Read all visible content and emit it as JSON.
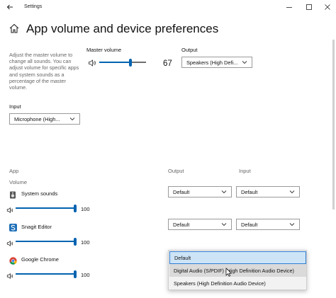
{
  "window": {
    "title": "Settings",
    "controls": {
      "minimize": "minimize-icon",
      "maximize": "maximize-icon",
      "close": "close-icon"
    }
  },
  "header": {
    "title": "App volume and device preferences",
    "home_icon": "home-icon",
    "back_icon": "back-arrow-icon"
  },
  "master": {
    "description": "Adjust the master volume to change all sounds. You can adjust volume for specific apps and system sounds as a percentage of the master volume.",
    "volume_label": "Master volume",
    "volume_value": "67",
    "volume_level": 0.67,
    "output_label": "Output",
    "output_value": "Speakers (High Defi...",
    "input_label": "Input",
    "input_value": "Microphone (High..."
  },
  "apps_table": {
    "app_header": "App",
    "volume_header": "Volume",
    "output_header": "Output",
    "input_header": "Input",
    "rows": [
      {
        "name": "System sounds",
        "volume": "100",
        "level": 1.0,
        "output": "Default",
        "input": "Default",
        "icon": "system-sounds-icon"
      },
      {
        "name": "Snagit Editor",
        "volume": "100",
        "level": 1.0,
        "output": "Default",
        "input": "Default",
        "icon": "snagit-icon"
      },
      {
        "name": "Google Chrome",
        "volume": "100",
        "level": 1.0,
        "icon": "chrome-icon"
      }
    ]
  },
  "output_popup": {
    "options": [
      "Default",
      "Digital Audio (S/PDIF) (High Definition Audio Device)",
      "Speakers (High Definition Audio Device)"
    ],
    "selected_index": 0,
    "hover_index": 1
  },
  "colors": {
    "accent": "#0063b1",
    "selected_bg": "#cde4f7",
    "selected_border": "#2d7dd2"
  }
}
